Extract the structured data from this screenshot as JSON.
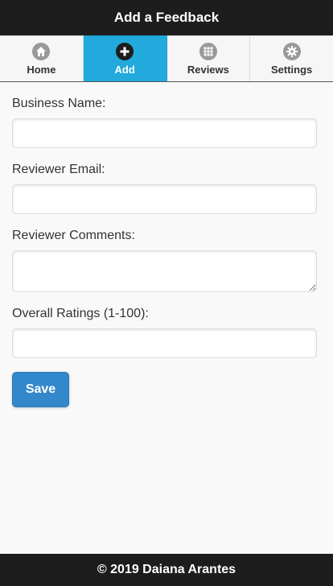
{
  "header": {
    "title": "Add a Feedback"
  },
  "nav": {
    "items": [
      {
        "label": "Home",
        "icon": "home-icon",
        "active": false
      },
      {
        "label": "Add",
        "icon": "plus-icon",
        "active": true
      },
      {
        "label": "Reviews",
        "icon": "grid-icon",
        "active": false
      },
      {
        "label": "Settings",
        "icon": "gear-icon",
        "active": false
      }
    ]
  },
  "form": {
    "business_name": {
      "label": "Business Name:",
      "value": ""
    },
    "reviewer_email": {
      "label": "Reviewer Email:",
      "value": ""
    },
    "reviewer_comments": {
      "label": "Reviewer Comments:",
      "value": ""
    },
    "overall_ratings": {
      "label": "Overall Ratings (1-100):",
      "value": ""
    },
    "save_label": "Save"
  },
  "footer": {
    "text": "© 2019 Daiana Arantes"
  },
  "colors": {
    "header_bg": "#1d1d1d",
    "active_tab": "#22aadd",
    "save_button": "#3388cc"
  }
}
